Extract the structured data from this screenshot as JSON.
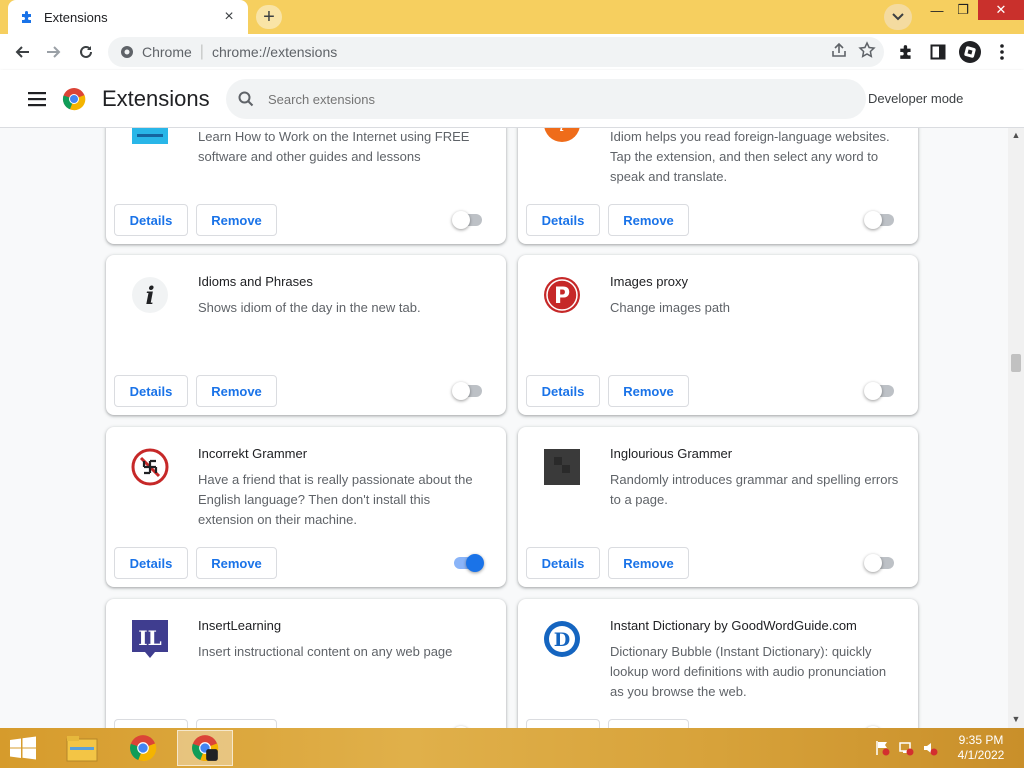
{
  "browser": {
    "tab_title": "Extensions",
    "tab_close": "×",
    "new_tab": "+",
    "omnibox_site": "Chrome",
    "omnibox_url": "chrome://extensions"
  },
  "window": {
    "minimize": "—",
    "maximize": "❐",
    "close": "✕"
  },
  "header": {
    "title": "Extensions",
    "search_placeholder": "Search extensions",
    "developer_mode_label": "Developer mode",
    "developer_mode_enabled": false
  },
  "buttons": {
    "details": "Details",
    "remove": "Remove"
  },
  "extensions": [
    {
      "name": "",
      "description": "Learn How to Work on the Internet using FREE software and other guides and lessons",
      "enabled": false,
      "icon": "learn-internet-icon"
    },
    {
      "name": "",
      "description": "Idiom helps you read foreign-language websites. Tap the extension, and then select any word to speak and translate.",
      "enabled": false,
      "icon": "idiom-icon"
    },
    {
      "name": "Idioms and Phrases",
      "description": "Shows idiom of the day in the new tab.",
      "enabled": false,
      "icon": "info-i-icon"
    },
    {
      "name": "Images proxy",
      "description": "Change images path",
      "enabled": false,
      "icon": "images-proxy-p-icon"
    },
    {
      "name": "Incorrekt Grammer",
      "description": "Have a friend that is really passionate about the English language? Then don't install this extension on their machine.",
      "enabled": true,
      "icon": "incorrekt-grammer-icon"
    },
    {
      "name": "Inglourious Grammer",
      "description": "Randomly introduces grammar and spelling errors to a page.",
      "enabled": false,
      "icon": "inglourious-grammer-icon"
    },
    {
      "name": "InsertLearning",
      "description": "Insert instructional content on any web page",
      "enabled": false,
      "icon": "insertlearning-il-icon"
    },
    {
      "name": "Instant Dictionary by GoodWordGuide.com",
      "description": "Dictionary Bubble (Instant Dictionary): quickly lookup word definitions with audio pronunciation as you browse the web.",
      "enabled": false,
      "icon": "instant-dictionary-d-icon"
    }
  ],
  "taskbar": {
    "time": "9:35 PM",
    "date": "4/1/2022"
  },
  "colors": {
    "tabstrip": "#f6cf5f",
    "accent": "#1a73e8",
    "taskbar": "#d9a53a"
  }
}
